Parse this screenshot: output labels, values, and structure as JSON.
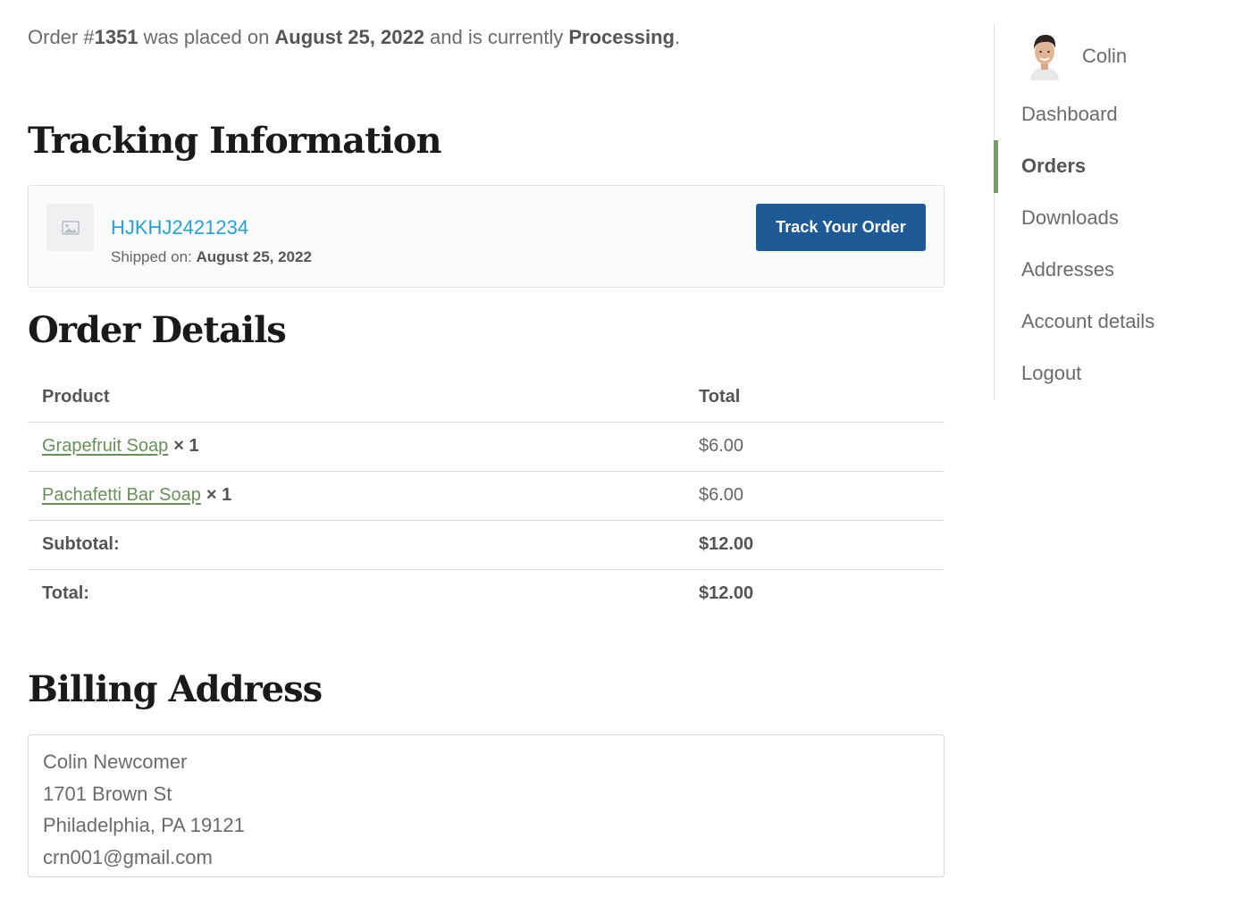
{
  "order_summary": {
    "prefix": "Order #",
    "number": "1351",
    "mid": " was placed on ",
    "date": "August 25, 2022",
    "mid2": " and is currently ",
    "status": "Processing",
    "suffix": "."
  },
  "tracking": {
    "heading": "Tracking Information",
    "number": "HJKHJ2421234",
    "shipped_label": "Shipped on: ",
    "shipped_date": "August 25, 2022",
    "button_label": "Track Your Order",
    "button_color": "#1d5a96",
    "thumb_icon": "image-placeholder-icon"
  },
  "order_details": {
    "heading": "Order Details",
    "columns": [
      "Product",
      "Total"
    ],
    "items": [
      {
        "name": "Grapefruit Soap",
        "qty": "× 1",
        "total": "$6.00"
      },
      {
        "name": "Pachafetti Bar Soap",
        "qty": "× 1",
        "total": "$6.00"
      }
    ],
    "subtotal_label": "Subtotal:",
    "subtotal_value": "$12.00",
    "total_label": "Total:",
    "total_value": "$12.00"
  },
  "billing": {
    "heading": "Billing Address",
    "lines": [
      "Colin Newcomer",
      "1701 Brown St",
      "Philadelphia, PA 19121",
      "crn001@gmail.com"
    ]
  },
  "sidebar": {
    "user_name": "Colin",
    "avatar_icon": "user-avatar",
    "active_color": "#7a9a6c",
    "items": [
      {
        "label": "Dashboard",
        "active": false
      },
      {
        "label": "Orders",
        "active": true
      },
      {
        "label": "Downloads",
        "active": false
      },
      {
        "label": "Addresses",
        "active": false
      },
      {
        "label": "Account details",
        "active": false
      },
      {
        "label": "Logout",
        "active": false
      }
    ]
  }
}
